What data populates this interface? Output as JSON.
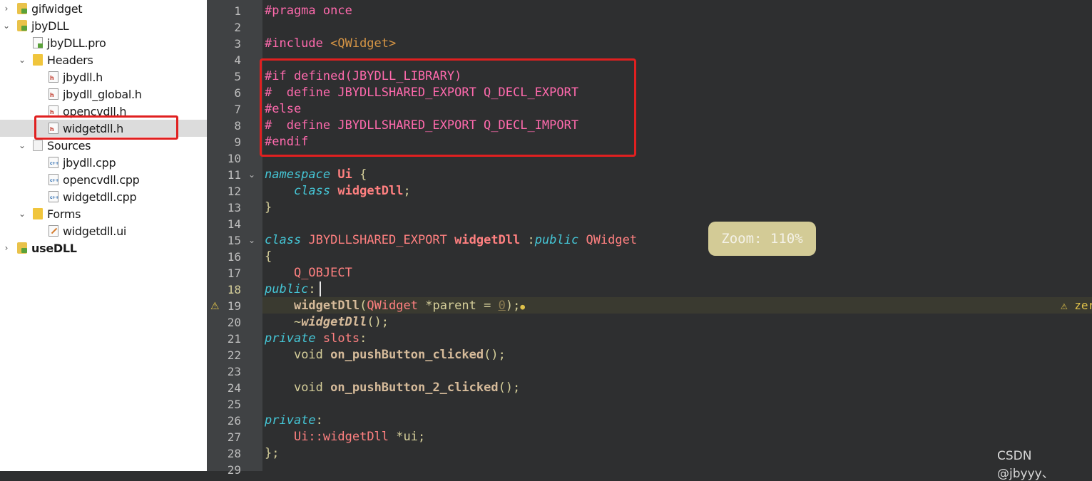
{
  "tree": {
    "gifwidget": "gifwidget",
    "jbydll": "jbyDLL",
    "jbydll_pro": "jbyDLL.pro",
    "headers": "Headers",
    "h1": "jbydll.h",
    "h2": "jbydll_global.h",
    "h3": "opencvdll.h",
    "h4": "widgetdll.h",
    "sources": "Sources",
    "s1": "jbydll.cpp",
    "s2": "opencvdll.cpp",
    "s3": "widgetdll.cpp",
    "forms": "Forms",
    "f1": "widgetdll.ui",
    "usedll": "useDLL"
  },
  "gutter": [
    "1",
    "2",
    "3",
    "4",
    "5",
    "6",
    "7",
    "8",
    "9",
    "10",
    "11",
    "12",
    "13",
    "14",
    "15",
    "16",
    "17",
    "18",
    "19",
    "20",
    "21",
    "22",
    "23",
    "24",
    "25",
    "26",
    "27",
    "28",
    "29"
  ],
  "code": {
    "l1": "#pragma once",
    "l3a": "#include ",
    "l3b": "<QWidget>",
    "l5": "#if defined(JBYDLL_LIBRARY)",
    "l6": "#  define JBYDLLSHARED_EXPORT Q_DECL_EXPORT",
    "l7": "#else",
    "l8": "#  define JBYDLLSHARED_EXPORT Q_DECL_IMPORT",
    "l9": "#endif",
    "l11a": "namespace",
    "l11b": "Ui",
    "l11c": "{",
    "l12a": "class",
    "l12b": "widgetDll",
    "l12c": ";",
    "l13": "}",
    "l15a": "class",
    "l15b": "JBYDLLSHARED_EXPORT",
    "l15c": "widgetDll",
    "l15d": ":",
    "l15e": "public",
    "l15f": "QWidget",
    "l16": "{",
    "l17": "Q_OBJECT",
    "l18a": "public",
    "l18b": ":",
    "l19a": "widgetDll",
    "l19b": "(",
    "l19c": "QWidget",
    "l19d": " *parent = ",
    "l19e": "0",
    "l19f": ");",
    "l20a": "~",
    "l20b": "widgetDll",
    "l20c": "();",
    "l21a": "private",
    "l21b": "slots",
    "l21c": ":",
    "l22a": "void",
    "l22b": "on_pushButton_clicked",
    "l22c": "();",
    "l24a": "void",
    "l24b": "on_pushButton_2_clicked",
    "l24c": "();",
    "l26a": "private",
    "l26b": ":",
    "l27a": "Ui::",
    "l27b": "widgetDll",
    "l27c": " *ui;",
    "l28": "};"
  },
  "zoom_label": "Zoom: 110%",
  "right_warning": "⚠ zer",
  "watermark": "CSDN @jbyyy、",
  "colors": {
    "editor_bg": "#2e2f30",
    "gutter_bg": "#404244",
    "highlight": "#e02020"
  }
}
